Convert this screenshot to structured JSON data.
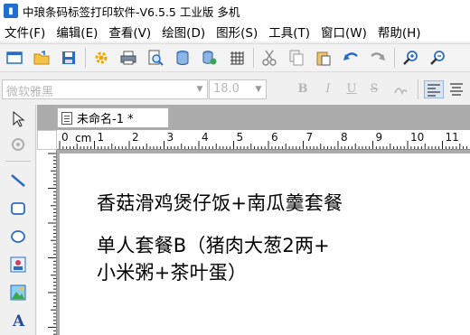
{
  "app": {
    "title": "中琅条码标签打印软件-V6.5.5 工业版 多机"
  },
  "menu": [
    {
      "label": "文件(F)"
    },
    {
      "label": "编辑(E)"
    },
    {
      "label": "查看(V)"
    },
    {
      "label": "绘图(D)"
    },
    {
      "label": "图形(S)"
    },
    {
      "label": "工具(T)"
    },
    {
      "label": "窗口(W)"
    },
    {
      "label": "帮助(H)"
    }
  ],
  "toolbar": {
    "icons": [
      "new-icon",
      "open-icon",
      "save-icon",
      "settings-icon",
      "print-icon",
      "print-preview-icon",
      "database-icon",
      "database-settings-icon",
      "grid-icon",
      "cut-icon",
      "copy-icon",
      "paste-icon",
      "undo-icon",
      "redo-icon",
      "zoom-in-icon",
      "zoom-out-icon"
    ]
  },
  "format": {
    "font_name": "微软雅黑",
    "font_size": "18.0",
    "bold": "B",
    "italic": "I",
    "underline": "U",
    "strike": "S"
  },
  "tools": {
    "icons": [
      "select-icon",
      "rotate-icon",
      "line-icon",
      "rounded-rect-icon",
      "ellipse-icon",
      "image-icon",
      "picture-icon",
      "text-icon"
    ]
  },
  "document": {
    "tab_label": "未命名-1 *",
    "ruler_unit": "cm",
    "ruler_ticks": [
      "0",
      "1",
      "2",
      "3",
      "4",
      "5",
      "6",
      "7",
      "8",
      "9",
      "10",
      "11"
    ],
    "text_lines": [
      "香菇滑鸡煲仔饭+南瓜羹套餐",
      "单人套餐B（猪肉大葱2两+",
      "小米粥+茶叶蛋）"
    ]
  },
  "colors": {
    "accent": "#1f6fd0",
    "workspace": "#ababab"
  }
}
